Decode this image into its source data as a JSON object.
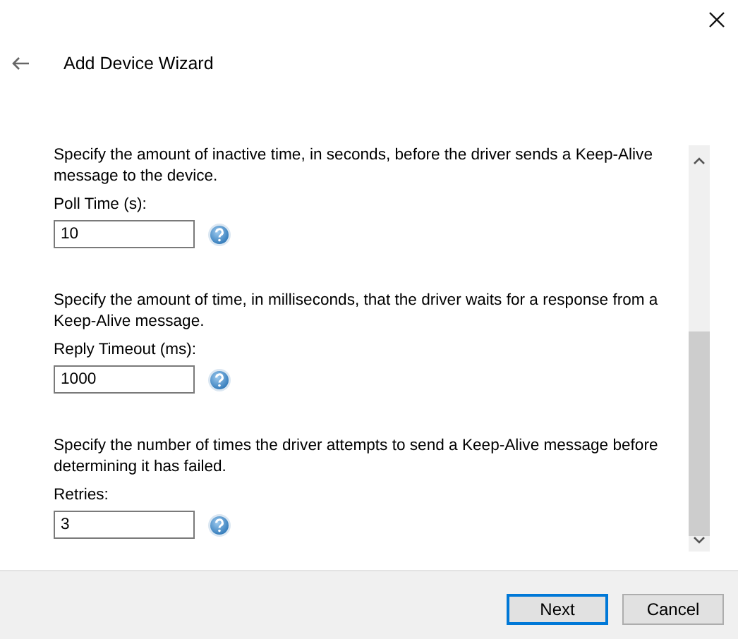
{
  "window": {
    "title": "Add Device Wizard"
  },
  "settings": [
    {
      "description": "Specify the amount of inactive time, in seconds, before the driver sends a Keep-Alive message to the device.",
      "label": "Poll Time (s):",
      "value": "10"
    },
    {
      "description": "Specify the amount of time, in milliseconds, that the driver waits for a response from a Keep-Alive message.",
      "label": "Reply Timeout (ms):",
      "value": "1000"
    },
    {
      "description": "Specify the number of times the driver attempts to send a Keep-Alive message before determining it has failed.",
      "label": "Retries:",
      "value": "3"
    }
  ],
  "buttons": [
    {
      "label": "Next",
      "default": true
    },
    {
      "label": "Cancel",
      "default": false
    }
  ]
}
